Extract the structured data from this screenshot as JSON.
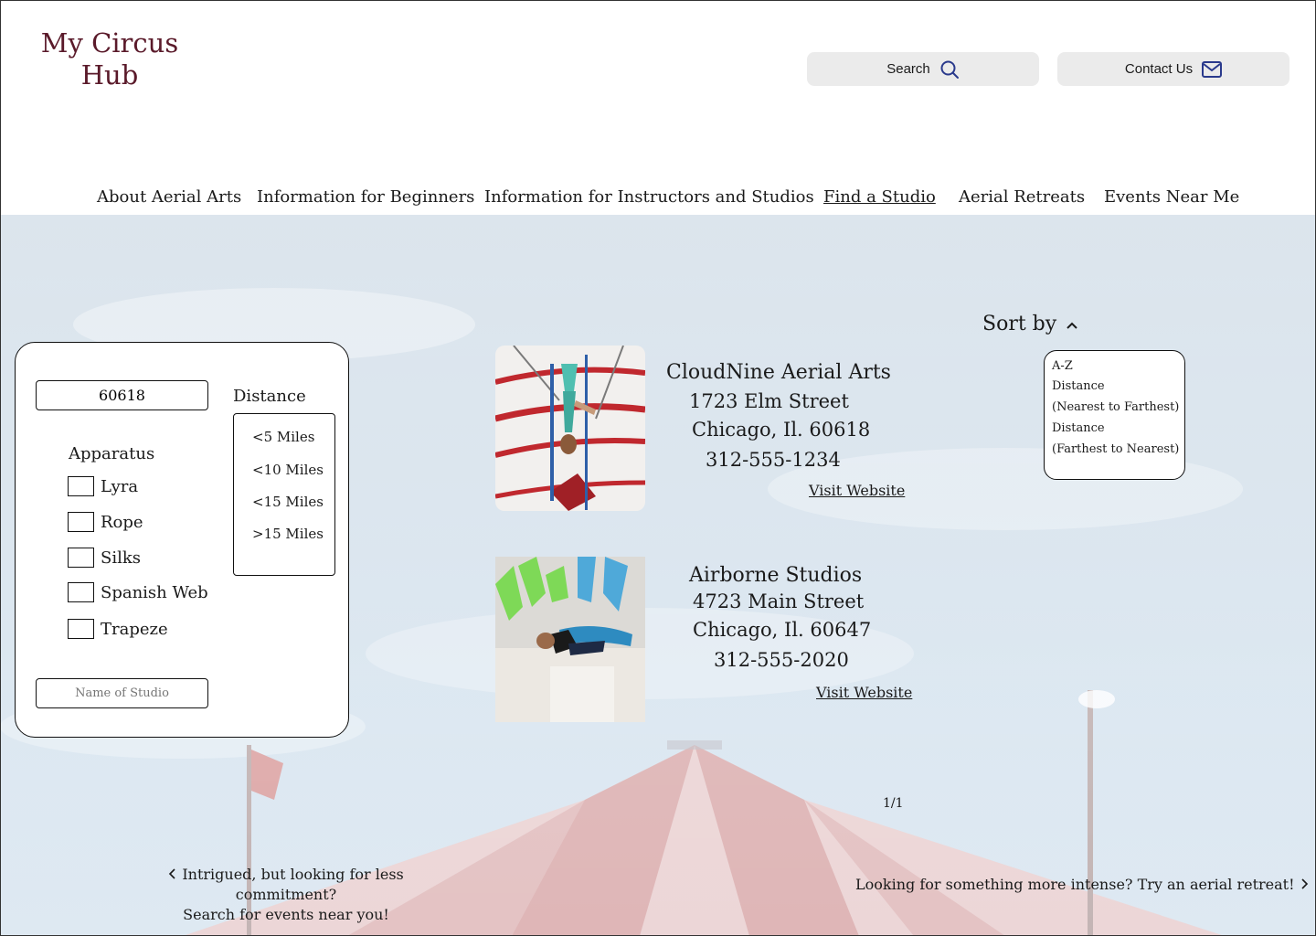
{
  "header": {
    "logo": "My Circus Hub",
    "search_label": "Search",
    "contact_label": "Contact Us"
  },
  "nav": {
    "items": [
      "About Aerial Arts",
      "Information for Beginners",
      "Information for Instructors and Studios",
      "Find a Studio",
      "Aerial Retreats",
      "Events Near Me"
    ],
    "active": "Find a Studio"
  },
  "filters": {
    "zip_value": "60618",
    "distance_label": "Distance",
    "distance_options": [
      "<5 Miles",
      "<10 Miles",
      "<15 Miles",
      ">15 Miles"
    ],
    "apparatus_label": "Apparatus",
    "apparatus_options": [
      "Lyra",
      "Rope",
      "Silks",
      "Spanish Web",
      "Trapeze"
    ],
    "studio_name_placeholder": "Name of Studio"
  },
  "sort": {
    "label": "Sort by",
    "options": [
      "A-Z",
      "Distance",
      "(Nearest to Farthest)",
      "Distance",
      "(Farthest to Nearest)"
    ]
  },
  "studios": [
    {
      "name": "CloudNine Aerial Arts",
      "street": "1723 Elm Street",
      "city": "Chicago, Il. 60618",
      "phone": "312-555-1234",
      "link": "Visit Website"
    },
    {
      "name": "Airborne Studios",
      "street": "4723 Main Street",
      "city": "Chicago, Il. 60647",
      "phone": "312-555-2020",
      "link": "Visit Website"
    }
  ],
  "pagination": "1/1",
  "footer": {
    "left_line1": "Intrigued, but looking for less commitment?",
    "left_line2": "Search for events near you!",
    "right": "Looking for something more intense? Try an aerial retreat!"
  },
  "colors": {
    "logo": "#5a1a2a",
    "header_button_bg": "#ebebeb",
    "hero_sky": "#cfdde9"
  }
}
